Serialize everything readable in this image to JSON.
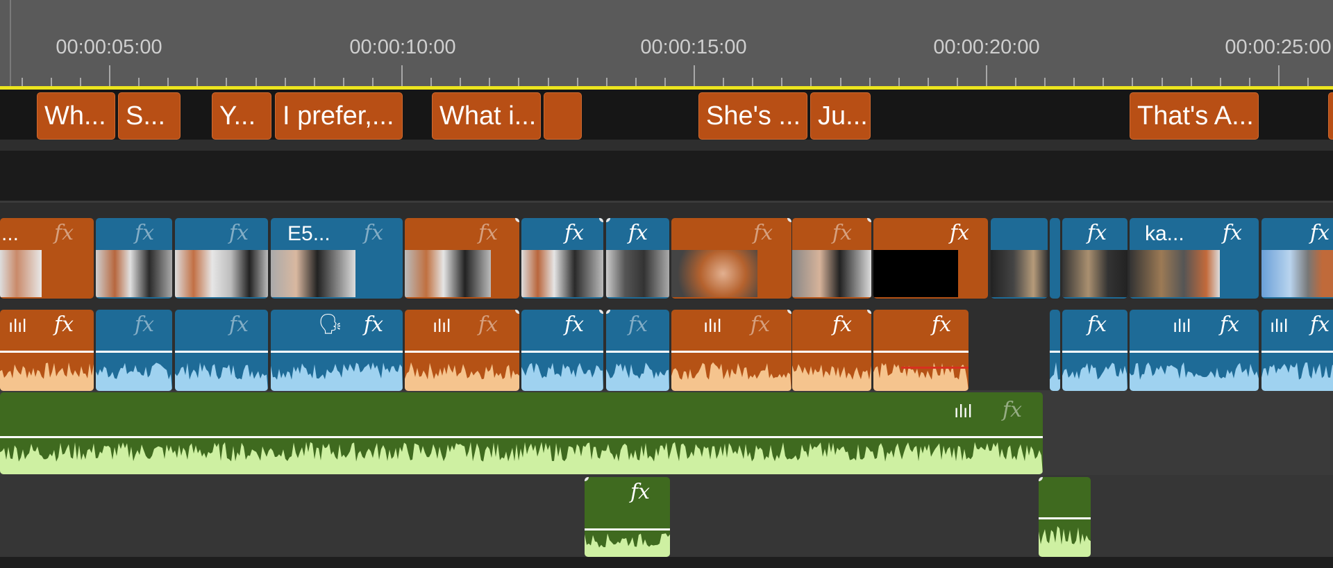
{
  "timeline": {
    "timecodes": [
      "00:00:05:00",
      "00:00:10:00",
      "00:00:15:00",
      "00:00:20:00",
      "00:00:25:00"
    ]
  },
  "captions": [
    "Wh...",
    "S...",
    "Y...",
    "I prefer,...",
    "What i...",
    "",
    "She's ...",
    "Ju...",
    "That's A..."
  ],
  "video_labels": [
    "...",
    "E5...",
    "ka..."
  ],
  "effects": {
    "fx_label": "fx"
  },
  "icons": {
    "audio_waveform": "waveform-icon",
    "speech": "speech-icon",
    "effect": "fx-icon"
  },
  "colors": {
    "caption": "#b84f15",
    "video_blue": "#1e6b97",
    "video_orange": "#b55215",
    "music_green": "#3f6a1f",
    "playhead": "#ece51e"
  }
}
